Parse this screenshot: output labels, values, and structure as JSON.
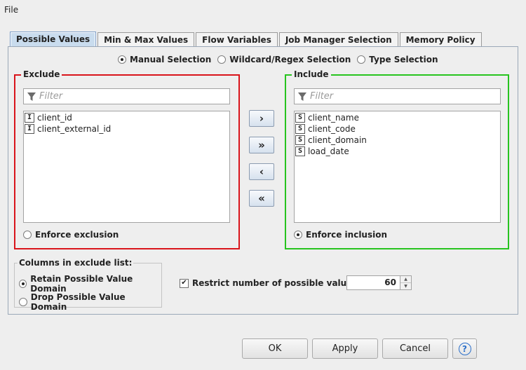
{
  "menu": {
    "file": "File"
  },
  "tabs": [
    {
      "label": "Possible Values",
      "active": true
    },
    {
      "label": "Min & Max Values",
      "active": false
    },
    {
      "label": "Flow Variables",
      "active": false
    },
    {
      "label": "Job Manager Selection",
      "active": false
    },
    {
      "label": "Memory Policy",
      "active": false
    }
  ],
  "selection_mode": {
    "options": [
      "Manual Selection",
      "Wildcard/Regex Selection",
      "Type Selection"
    ],
    "selected": "Manual Selection"
  },
  "exclude": {
    "title": "Exclude",
    "filter_placeholder": "Filter",
    "items": [
      {
        "type": "I",
        "name": "client_id"
      },
      {
        "type": "I",
        "name": "client_external_id"
      }
    ],
    "enforce_label": "Enforce exclusion",
    "enforce_selected": false,
    "border_color": "#d9141b"
  },
  "include": {
    "title": "Include",
    "filter_placeholder": "Filter",
    "items": [
      {
        "type": "S",
        "name": "client_name"
      },
      {
        "type": "S",
        "name": "client_code"
      },
      {
        "type": "S",
        "name": "client_domain"
      },
      {
        "type": "S",
        "name": "load_date"
      }
    ],
    "enforce_label": "Enforce inclusion",
    "enforce_selected": true,
    "border_color": "#27c41f"
  },
  "move_buttons": {
    "add": "›",
    "add_all": "»",
    "remove": "‹",
    "remove_all": "«"
  },
  "columns_in_exclude": {
    "title": "Columns in exclude list:",
    "options": [
      "Retain Possible Value Domain",
      "Drop Possible Value Domain"
    ],
    "selected": "Retain Possible Value Domain"
  },
  "restrict": {
    "label": "Restrict number of possible values:",
    "checked": true,
    "value": "60"
  },
  "footer": {
    "ok": "OK",
    "apply": "Apply",
    "cancel": "Cancel",
    "help": "?"
  }
}
